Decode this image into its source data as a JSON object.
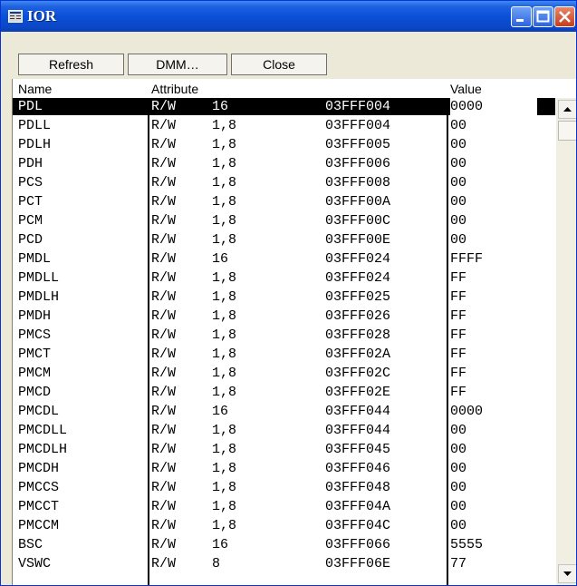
{
  "window": {
    "title": "IOR"
  },
  "toolbar": {
    "refresh": "Refresh",
    "dmm": "DMM…",
    "close": "Close"
  },
  "columns": {
    "name": "Name",
    "attribute": "Attribute",
    "value": "Value"
  },
  "rows": [
    {
      "name": "PDL",
      "rw": "R/W",
      "size": "16",
      "addr": "03FFF004",
      "value": "0000",
      "selected": true
    },
    {
      "name": "PDLL",
      "rw": "R/W",
      "size": "1,8",
      "addr": "03FFF004",
      "value": "00"
    },
    {
      "name": "PDLH",
      "rw": "R/W",
      "size": "1,8",
      "addr": "03FFF005",
      "value": "00"
    },
    {
      "name": "PDH",
      "rw": "R/W",
      "size": "1,8",
      "addr": "03FFF006",
      "value": "00"
    },
    {
      "name": "PCS",
      "rw": "R/W",
      "size": "1,8",
      "addr": "03FFF008",
      "value": "00"
    },
    {
      "name": "PCT",
      "rw": "R/W",
      "size": "1,8",
      "addr": "03FFF00A",
      "value": "00"
    },
    {
      "name": "PCM",
      "rw": "R/W",
      "size": "1,8",
      "addr": "03FFF00C",
      "value": "00"
    },
    {
      "name": "PCD",
      "rw": "R/W",
      "size": "1,8",
      "addr": "03FFF00E",
      "value": "00"
    },
    {
      "name": "PMDL",
      "rw": "R/W",
      "size": "16",
      "addr": "03FFF024",
      "value": "FFFF"
    },
    {
      "name": "PMDLL",
      "rw": "R/W",
      "size": "1,8",
      "addr": "03FFF024",
      "value": "FF"
    },
    {
      "name": "PMDLH",
      "rw": "R/W",
      "size": "1,8",
      "addr": "03FFF025",
      "value": "FF"
    },
    {
      "name": "PMDH",
      "rw": "R/W",
      "size": "1,8",
      "addr": "03FFF026",
      "value": "FF"
    },
    {
      "name": "PMCS",
      "rw": "R/W",
      "size": "1,8",
      "addr": "03FFF028",
      "value": "FF"
    },
    {
      "name": "PMCT",
      "rw": "R/W",
      "size": "1,8",
      "addr": "03FFF02A",
      "value": "FF"
    },
    {
      "name": "PMCM",
      "rw": "R/W",
      "size": "1,8",
      "addr": "03FFF02C",
      "value": "FF"
    },
    {
      "name": "PMCD",
      "rw": "R/W",
      "size": "1,8",
      "addr": "03FFF02E",
      "value": "FF"
    },
    {
      "name": "PMCDL",
      "rw": "R/W",
      "size": "16",
      "addr": "03FFF044",
      "value": "0000"
    },
    {
      "name": "PMCDLL",
      "rw": "R/W",
      "size": "1,8",
      "addr": "03FFF044",
      "value": "00"
    },
    {
      "name": "PMCDLH",
      "rw": "R/W",
      "size": "1,8",
      "addr": "03FFF045",
      "value": "00"
    },
    {
      "name": "PMCDH",
      "rw": "R/W",
      "size": "1,8",
      "addr": "03FFF046",
      "value": "00"
    },
    {
      "name": "PMCCS",
      "rw": "R/W",
      "size": "1,8",
      "addr": "03FFF048",
      "value": "00"
    },
    {
      "name": "PMCCT",
      "rw": "R/W",
      "size": "1,8",
      "addr": "03FFF04A",
      "value": "00"
    },
    {
      "name": "PMCCM",
      "rw": "R/W",
      "size": "1,8",
      "addr": "03FFF04C",
      "value": "00"
    },
    {
      "name": "BSC",
      "rw": "R/W",
      "size": "16",
      "addr": "03FFF066",
      "value": "5555"
    },
    {
      "name": "VSWC",
      "rw": "R/W",
      "size": "8",
      "addr": "03FFF06E",
      "value": "77"
    }
  ],
  "colors": {
    "titlebar": "#0a50d8",
    "selection": "#000000",
    "window_bg": "#ece9d8"
  }
}
